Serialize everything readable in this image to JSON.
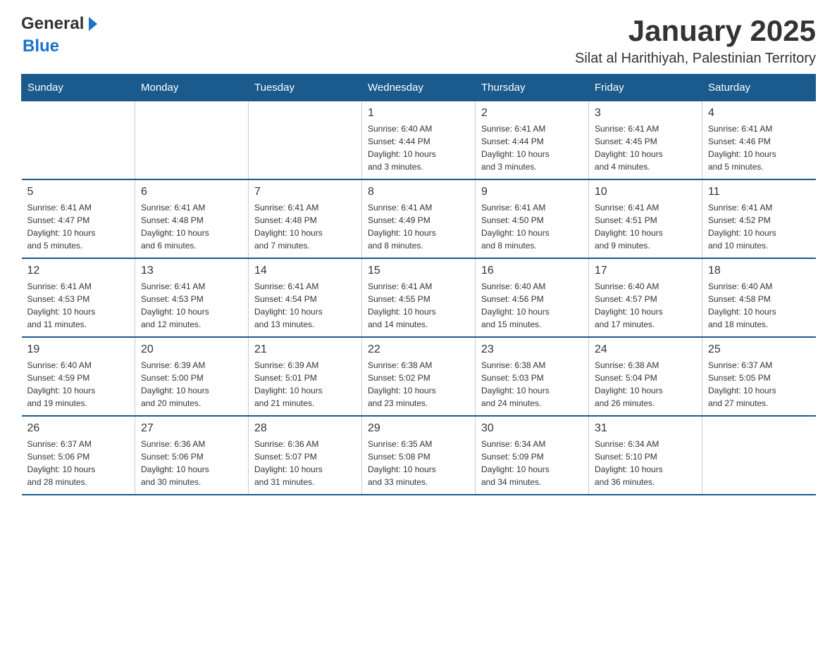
{
  "header": {
    "logo_general": "General",
    "logo_blue": "Blue",
    "title": "January 2025",
    "subtitle": "Silat al Harithiyah, Palestinian Territory"
  },
  "weekdays": [
    "Sunday",
    "Monday",
    "Tuesday",
    "Wednesday",
    "Thursday",
    "Friday",
    "Saturday"
  ],
  "weeks": [
    [
      {
        "day": "",
        "info": ""
      },
      {
        "day": "",
        "info": ""
      },
      {
        "day": "",
        "info": ""
      },
      {
        "day": "1",
        "info": "Sunrise: 6:40 AM\nSunset: 4:44 PM\nDaylight: 10 hours\nand 3 minutes."
      },
      {
        "day": "2",
        "info": "Sunrise: 6:41 AM\nSunset: 4:44 PM\nDaylight: 10 hours\nand 3 minutes."
      },
      {
        "day": "3",
        "info": "Sunrise: 6:41 AM\nSunset: 4:45 PM\nDaylight: 10 hours\nand 4 minutes."
      },
      {
        "day": "4",
        "info": "Sunrise: 6:41 AM\nSunset: 4:46 PM\nDaylight: 10 hours\nand 5 minutes."
      }
    ],
    [
      {
        "day": "5",
        "info": "Sunrise: 6:41 AM\nSunset: 4:47 PM\nDaylight: 10 hours\nand 5 minutes."
      },
      {
        "day": "6",
        "info": "Sunrise: 6:41 AM\nSunset: 4:48 PM\nDaylight: 10 hours\nand 6 minutes."
      },
      {
        "day": "7",
        "info": "Sunrise: 6:41 AM\nSunset: 4:48 PM\nDaylight: 10 hours\nand 7 minutes."
      },
      {
        "day": "8",
        "info": "Sunrise: 6:41 AM\nSunset: 4:49 PM\nDaylight: 10 hours\nand 8 minutes."
      },
      {
        "day": "9",
        "info": "Sunrise: 6:41 AM\nSunset: 4:50 PM\nDaylight: 10 hours\nand 8 minutes."
      },
      {
        "day": "10",
        "info": "Sunrise: 6:41 AM\nSunset: 4:51 PM\nDaylight: 10 hours\nand 9 minutes."
      },
      {
        "day": "11",
        "info": "Sunrise: 6:41 AM\nSunset: 4:52 PM\nDaylight: 10 hours\nand 10 minutes."
      }
    ],
    [
      {
        "day": "12",
        "info": "Sunrise: 6:41 AM\nSunset: 4:53 PM\nDaylight: 10 hours\nand 11 minutes."
      },
      {
        "day": "13",
        "info": "Sunrise: 6:41 AM\nSunset: 4:53 PM\nDaylight: 10 hours\nand 12 minutes."
      },
      {
        "day": "14",
        "info": "Sunrise: 6:41 AM\nSunset: 4:54 PM\nDaylight: 10 hours\nand 13 minutes."
      },
      {
        "day": "15",
        "info": "Sunrise: 6:41 AM\nSunset: 4:55 PM\nDaylight: 10 hours\nand 14 minutes."
      },
      {
        "day": "16",
        "info": "Sunrise: 6:40 AM\nSunset: 4:56 PM\nDaylight: 10 hours\nand 15 minutes."
      },
      {
        "day": "17",
        "info": "Sunrise: 6:40 AM\nSunset: 4:57 PM\nDaylight: 10 hours\nand 17 minutes."
      },
      {
        "day": "18",
        "info": "Sunrise: 6:40 AM\nSunset: 4:58 PM\nDaylight: 10 hours\nand 18 minutes."
      }
    ],
    [
      {
        "day": "19",
        "info": "Sunrise: 6:40 AM\nSunset: 4:59 PM\nDaylight: 10 hours\nand 19 minutes."
      },
      {
        "day": "20",
        "info": "Sunrise: 6:39 AM\nSunset: 5:00 PM\nDaylight: 10 hours\nand 20 minutes."
      },
      {
        "day": "21",
        "info": "Sunrise: 6:39 AM\nSunset: 5:01 PM\nDaylight: 10 hours\nand 21 minutes."
      },
      {
        "day": "22",
        "info": "Sunrise: 6:38 AM\nSunset: 5:02 PM\nDaylight: 10 hours\nand 23 minutes."
      },
      {
        "day": "23",
        "info": "Sunrise: 6:38 AM\nSunset: 5:03 PM\nDaylight: 10 hours\nand 24 minutes."
      },
      {
        "day": "24",
        "info": "Sunrise: 6:38 AM\nSunset: 5:04 PM\nDaylight: 10 hours\nand 26 minutes."
      },
      {
        "day": "25",
        "info": "Sunrise: 6:37 AM\nSunset: 5:05 PM\nDaylight: 10 hours\nand 27 minutes."
      }
    ],
    [
      {
        "day": "26",
        "info": "Sunrise: 6:37 AM\nSunset: 5:06 PM\nDaylight: 10 hours\nand 28 minutes."
      },
      {
        "day": "27",
        "info": "Sunrise: 6:36 AM\nSunset: 5:06 PM\nDaylight: 10 hours\nand 30 minutes."
      },
      {
        "day": "28",
        "info": "Sunrise: 6:36 AM\nSunset: 5:07 PM\nDaylight: 10 hours\nand 31 minutes."
      },
      {
        "day": "29",
        "info": "Sunrise: 6:35 AM\nSunset: 5:08 PM\nDaylight: 10 hours\nand 33 minutes."
      },
      {
        "day": "30",
        "info": "Sunrise: 6:34 AM\nSunset: 5:09 PM\nDaylight: 10 hours\nand 34 minutes."
      },
      {
        "day": "31",
        "info": "Sunrise: 6:34 AM\nSunset: 5:10 PM\nDaylight: 10 hours\nand 36 minutes."
      },
      {
        "day": "",
        "info": ""
      }
    ]
  ]
}
